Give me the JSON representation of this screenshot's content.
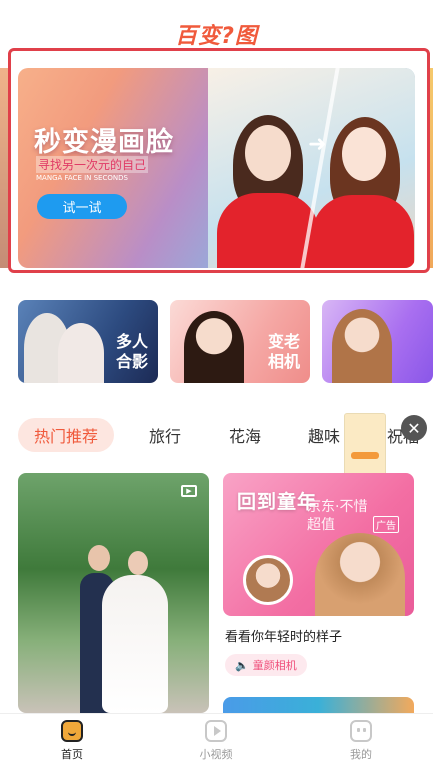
{
  "app": {
    "logo_text": "百变?图"
  },
  "banner": {
    "title": "秒变漫画脸",
    "subtitle": "寻找另一次元的自己",
    "subtitle_en": "MANGA FACE IN SECONDS",
    "try_button": "试一试"
  },
  "features": [
    {
      "label_line1": "多人",
      "label_line2": "合影"
    },
    {
      "label_line1": "变老",
      "label_line2": "相机"
    }
  ],
  "categories": [
    "热门推荐",
    "旅行",
    "花海",
    "趣味",
    "祝福"
  ],
  "ad_overlay": {
    "line1": "京东·不惜",
    "line2": "超值",
    "tag": "广告"
  },
  "cards": {
    "right": {
      "heading": "回到童年",
      "caption": "看看你年轻时的样子",
      "tag": "童颜相机"
    }
  },
  "tabbar": {
    "home": "首页",
    "video": "小视频",
    "mine": "我的"
  },
  "colors": {
    "accent": "#f05a3c",
    "selection_frame": "#e0404a",
    "button_blue": "#1e9bf0",
    "tag_pink": "#f0507c"
  }
}
